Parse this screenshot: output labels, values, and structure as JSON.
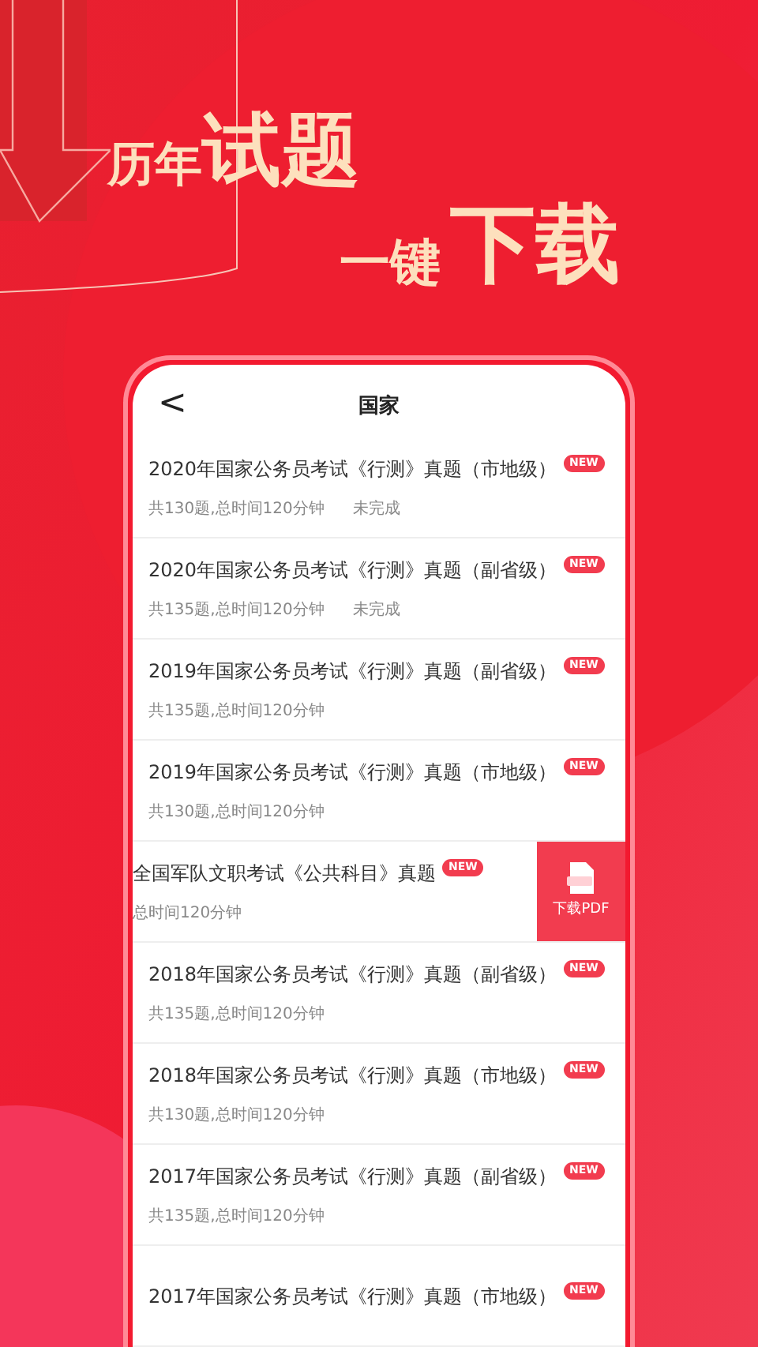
{
  "headline": {
    "line1_small": "历年",
    "line1_large": "试题",
    "line2_small": "一键",
    "line2_large": "下载"
  },
  "header": {
    "back": "<",
    "title": "国家"
  },
  "rows": [
    {
      "kind": "normal",
      "title": "2020年国家公务员考试《行测》真题（市地级）",
      "meta": "共130题,总时间120分钟",
      "status": "未完成",
      "badge": "NEW"
    },
    {
      "kind": "normal",
      "title": "2020年国家公务员考试《行测》真题（副省级）",
      "meta": "共135题,总时间120分钟",
      "status": "未完成",
      "badge": "NEW"
    },
    {
      "kind": "normal",
      "title": "2019年国家公务员考试《行测》真题（副省级）",
      "meta": "共135题,总时间120分钟",
      "badge": "NEW"
    },
    {
      "kind": "normal",
      "title": "2019年国家公务员考试《行测》真题（市地级）",
      "meta": "共130题,总时间120分钟",
      "badge": "NEW"
    },
    {
      "kind": "swiped",
      "title": "全国军队文职考试《公共科目》真题",
      "meta": "总时间120分钟",
      "badge": "NEW",
      "action": "下载PDF"
    },
    {
      "kind": "normal",
      "title": "2018年国家公务员考试《行测》真题（副省级）",
      "meta": "共135题,总时间120分钟",
      "badge": "NEW"
    },
    {
      "kind": "normal",
      "title": "2018年国家公务员考试《行测》真题（市地级）",
      "meta": "共130题,总时间120分钟",
      "badge": "NEW"
    },
    {
      "kind": "normal",
      "title": "2017年国家公务员考试《行测》真题（副省级）",
      "meta": "共135题,总时间120分钟",
      "badge": "NEW"
    },
    {
      "kind": "normal",
      "title": "2017年国家公务员考试《行测》真题（市地级）",
      "badge": "NEW"
    }
  ]
}
